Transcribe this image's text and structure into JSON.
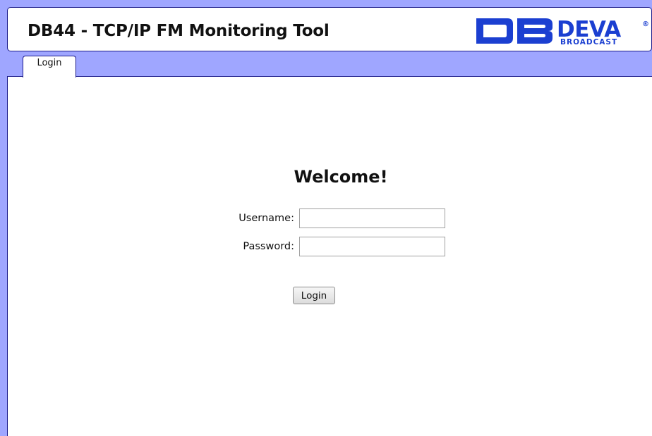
{
  "header": {
    "title": "DB44 - TCP/IP FM Monitoring Tool",
    "logo": {
      "brand": "DEVA",
      "sub": "BROADCAST",
      "mark": "®",
      "icon": "deva-broadcast-logo",
      "color": "#1b3fd1"
    }
  },
  "tabs": [
    {
      "label": "Login",
      "active": true
    }
  ],
  "login": {
    "welcome": "Welcome!",
    "username_label": "Username:",
    "username_value": "",
    "password_label": "Password:",
    "password_value": "",
    "submit_label": "Login"
  },
  "colors": {
    "background": "#9fa6ff",
    "border": "#1a1a8a",
    "panel": "#ffffff"
  }
}
